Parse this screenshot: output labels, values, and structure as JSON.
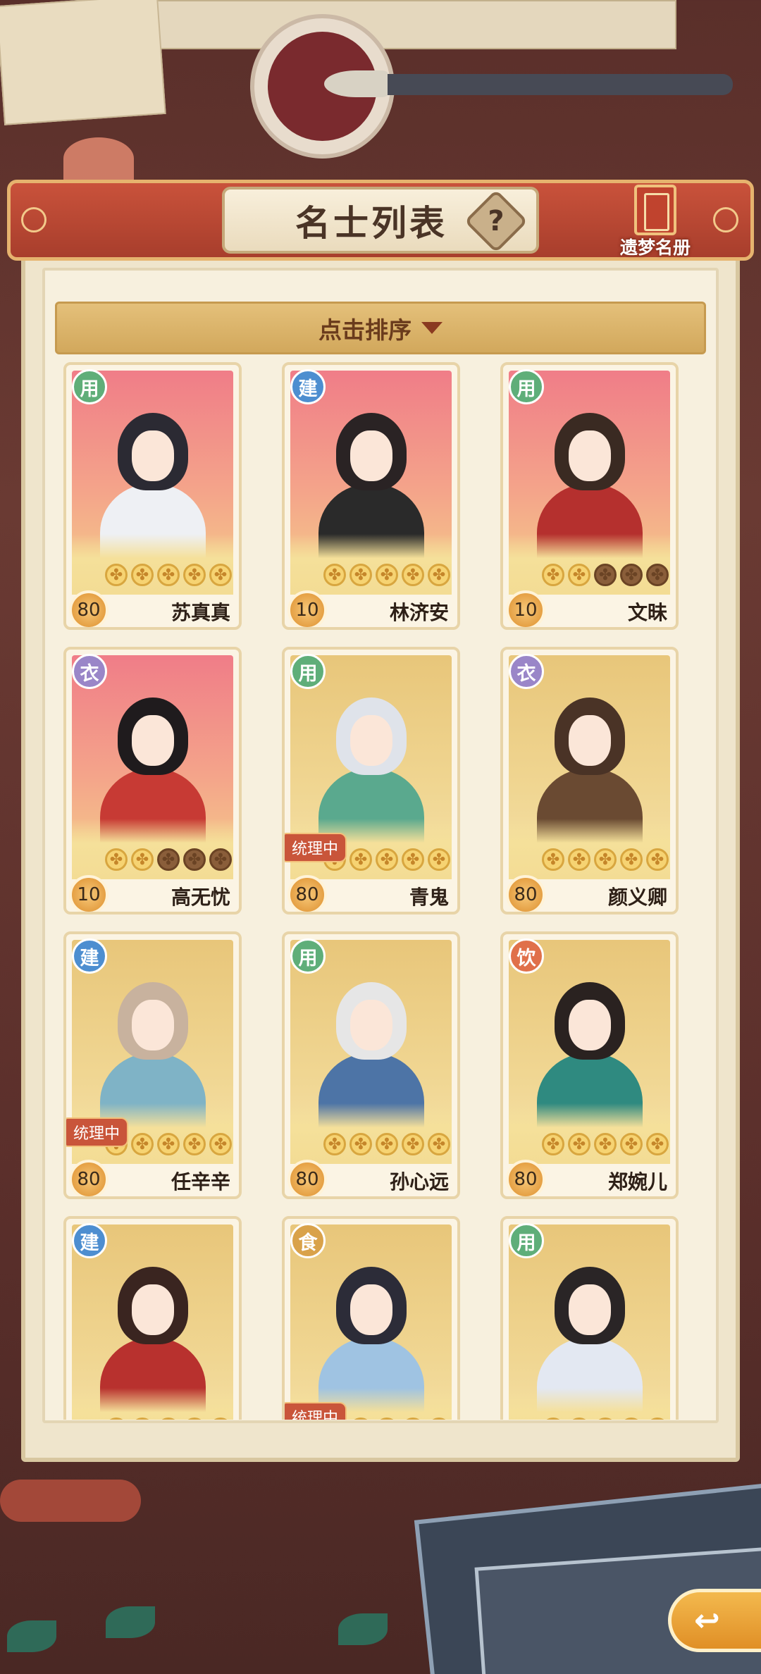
{
  "header": {
    "title": "名士列表",
    "help_icon": "?",
    "book_label": "遗梦名册"
  },
  "sort": {
    "label": "点击排序"
  },
  "cards": [
    {
      "name": "苏真真",
      "level": "80",
      "role": "用",
      "role_color": "green",
      "stars_on": 5,
      "stars_total": 5,
      "bg": "pink",
      "badge": ""
    },
    {
      "name": "林济安",
      "level": "10",
      "role": "建",
      "role_color": "blue",
      "stars_on": 5,
      "stars_total": 5,
      "bg": "pink",
      "badge": ""
    },
    {
      "name": "文昧",
      "level": "10",
      "role": "用",
      "role_color": "green",
      "stars_on": 2,
      "stars_total": 5,
      "bg": "pink",
      "badge": ""
    },
    {
      "name": "高无忧",
      "level": "10",
      "role": "衣",
      "role_color": "purple",
      "stars_on": 2,
      "stars_total": 5,
      "bg": "pink",
      "badge": ""
    },
    {
      "name": "青鬼",
      "level": "80",
      "role": "用",
      "role_color": "green",
      "stars_on": 5,
      "stars_total": 5,
      "bg": "gold",
      "badge": "统理中"
    },
    {
      "name": "颜义卿",
      "level": "80",
      "role": "衣",
      "role_color": "purple",
      "stars_on": 5,
      "stars_total": 5,
      "bg": "gold",
      "badge": ""
    },
    {
      "name": "任辛辛",
      "level": "80",
      "role": "建",
      "role_color": "blue",
      "stars_on": 5,
      "stars_total": 5,
      "bg": "gold",
      "badge": "统理中"
    },
    {
      "name": "孙心远",
      "level": "80",
      "role": "用",
      "role_color": "green",
      "stars_on": 5,
      "stars_total": 5,
      "bg": "gold",
      "badge": ""
    },
    {
      "name": "郑婉儿",
      "level": "80",
      "role": "饮",
      "role_color": "red",
      "stars_on": 5,
      "stars_total": 5,
      "bg": "gold",
      "badge": ""
    },
    {
      "name": "",
      "level": "",
      "role": "建",
      "role_color": "blue",
      "stars_on": 5,
      "stars_total": 5,
      "bg": "gold",
      "badge": ""
    },
    {
      "name": "",
      "level": "",
      "role": "食",
      "role_color": "orange",
      "stars_on": 5,
      "stars_total": 5,
      "bg": "gold",
      "badge": "统理中"
    },
    {
      "name": "",
      "level": "",
      "role": "用",
      "role_color": "green",
      "stars_on": 5,
      "stars_total": 5,
      "bg": "gold",
      "badge": ""
    }
  ],
  "colors": {
    "header_red": "#b8442f",
    "panel": "#f7f0de",
    "sort_bar": "#dcb46a",
    "star_on": "#f6d372",
    "star_off": "#8a5e3a"
  },
  "icons": {
    "back_button": "back-arrow-icon",
    "book": "book-icon"
  }
}
